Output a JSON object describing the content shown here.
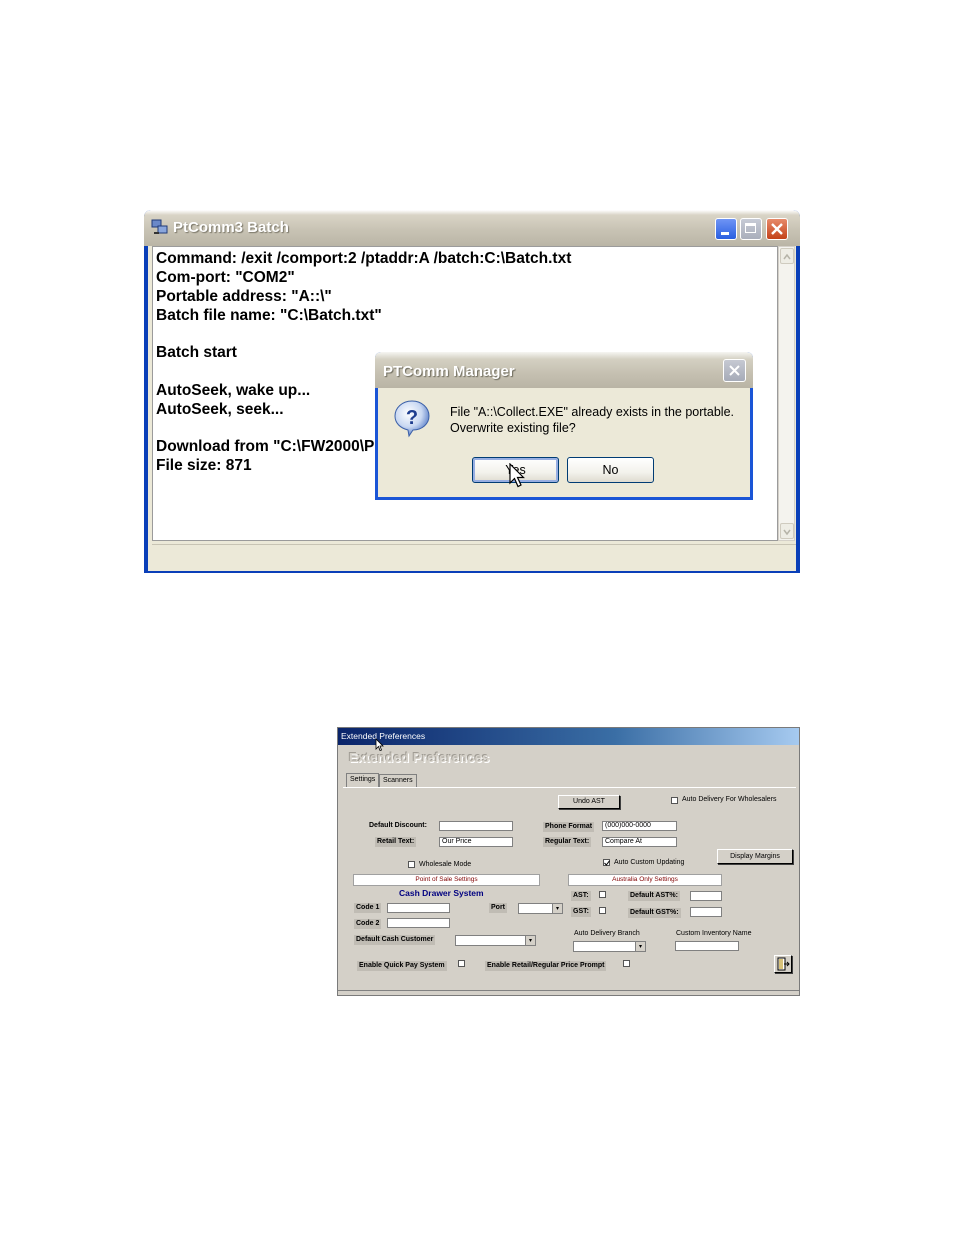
{
  "batch_window": {
    "title": "PtComm3 Batch",
    "lines": [
      "Command: /exit /comport:2 /ptaddr:A /batch:C:\\Batch.txt",
      "Com-port: \"COM2\"",
      "Portable address: \"A::\\\"",
      "Batch file name: \"C:\\Batch.txt\"",
      "Batch start",
      "AutoSeek, wake up...",
      "AutoSeek, seek...",
      "Download from \"C:\\FW2000\\P",
      "File size: 871"
    ]
  },
  "dialog": {
    "title": "PTComm Manager",
    "message_line1": "File \"A::\\Collect.EXE\" already exists in the portable.",
    "message_line2": "Overwrite existing file?",
    "yes_label": "Yes",
    "no_label": "No"
  },
  "prefs_window": {
    "title": "Extended Preferences",
    "heading": "Extended Preferences",
    "tabs": [
      "Settings",
      "Scanners"
    ],
    "undo_ast": "Undo AST",
    "auto_delivery_wholesalers": "Auto Delivery For Wholesalers",
    "default_discount_label": "Default Discount:",
    "retail_text_label": "Retail Text:",
    "retail_text_value": "Our Price",
    "phone_format_label": "Phone Format",
    "phone_format_value": "(000)000-0000",
    "regular_text_label": "Regular Text:",
    "regular_text_value": "Compare At",
    "wholesale_mode": "Wholesale Mode",
    "auto_custom_updating": "Auto Custom Updating",
    "display_margins": "Display Margins",
    "pos_settings": "Point of Sale Settings",
    "australia_settings": "Australia Only Settings",
    "cash_drawer_system": "Cash Drawer System",
    "code1": "Code 1",
    "code2": "Code 2",
    "port_label": "Port",
    "default_cash_customer": "Default Cash Customer",
    "ast_label": "AST:",
    "gst_label": "GST:",
    "default_ast": "Default AST%:",
    "default_gst": "Default GST%:",
    "auto_delivery_branch": "Auto Delivery Branch",
    "custom_inventory_name": "Custom Inventory Name",
    "enable_quick_pay": "Enable Quick Pay System",
    "enable_retail_regular": "Enable Retail/Regular Price Prompt"
  }
}
